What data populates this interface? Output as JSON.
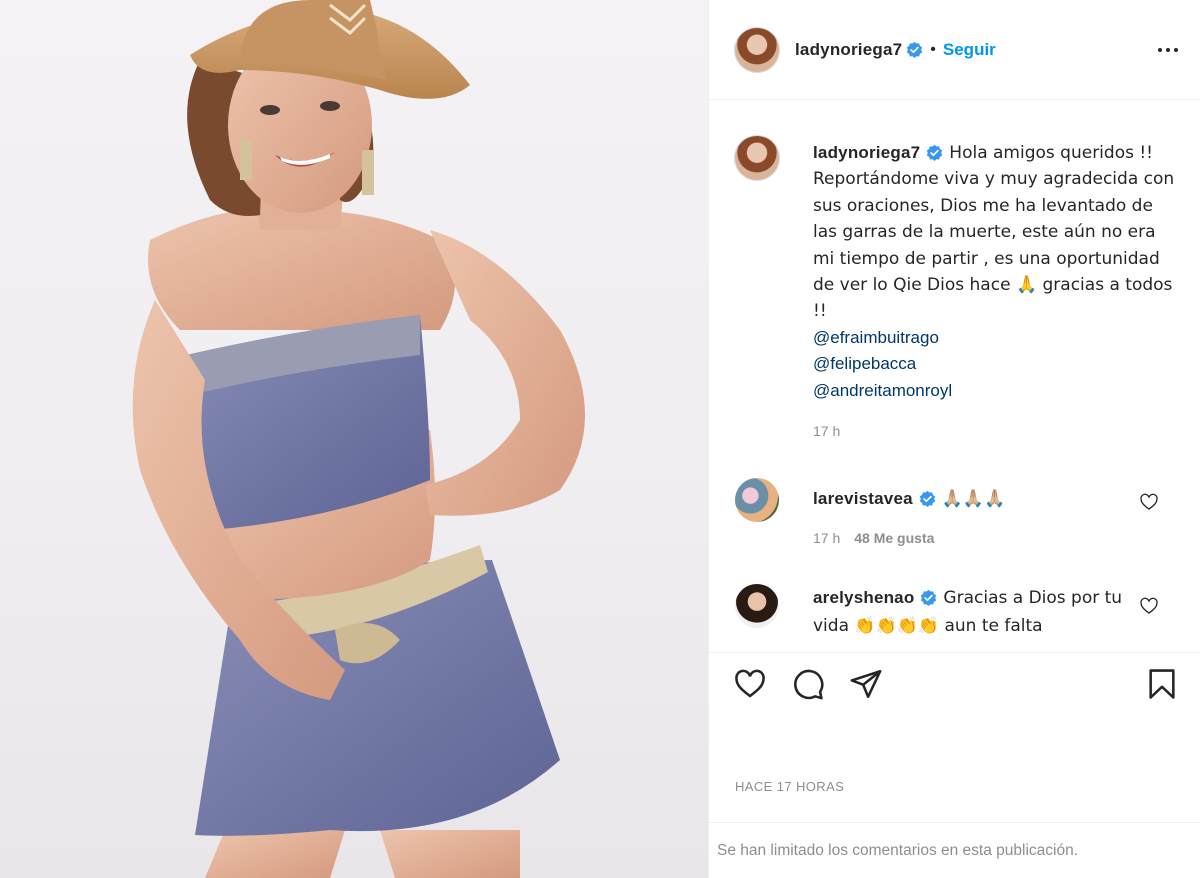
{
  "post": {
    "author": "ladynoriega7",
    "follow_label": "Seguir",
    "separator": "•"
  },
  "caption": {
    "username": "ladynoriega7",
    "text": "Hola amigos queridos !! Reportándome viva y muy agradecida con sus oraciones, Dios me ha levantado de las garras de la muerte, este aún no era mi tiempo de partir , es una oportunidad de ver lo Qie Dios hace 🙏 gracias a todos !!",
    "mentions": [
      "@efraimbuitrago",
      "@felipebacca",
      "@andreitamonroyl"
    ],
    "age": "17 h"
  },
  "comments": [
    {
      "username": "larevistavea",
      "text": "🙏🏼🙏🏼🙏🏼",
      "age": "17 h",
      "likes": "48 Me gusta"
    },
    {
      "username": "arelyshenao",
      "text": "Gracias a Dios por tu vida 👏👏👏👏 aun te falta"
    }
  ],
  "actions": {
    "like_icon": "heart-icon",
    "comment_icon": "comment-icon",
    "share_icon": "share-icon",
    "save_icon": "bookmark-icon"
  },
  "timestamp": "HACE 17 HORAS",
  "limited_notice": "Se han limitado los comentarios en esta publicación.",
  "colors": {
    "link": "#0095f6",
    "mention": "#00376b",
    "muted": "#8e8e8e",
    "verified": "#3897f0"
  }
}
